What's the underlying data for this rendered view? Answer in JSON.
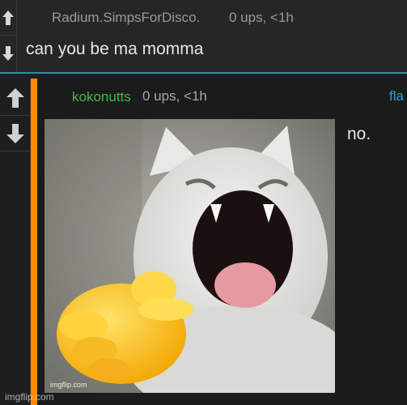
{
  "comment1": {
    "author": "Radium.SimpsForDisco.",
    "meta": "0 ups, <1h",
    "body": "can you be ma momma"
  },
  "comment2": {
    "author": "kokonutts",
    "meta": "0 ups, <1h",
    "flag": "fla",
    "body": "no.",
    "meme_tag": "imgflip.com"
  },
  "watermark": "imgflip.com",
  "colors": {
    "thread_bar": "#ff8a00",
    "author_green": "#46b846",
    "flag_blue": "#1fa3e0",
    "divider_teal": "#2f8fa3"
  },
  "icons": [
    "upvote-arrow-icon",
    "downvote-arrow-icon"
  ]
}
